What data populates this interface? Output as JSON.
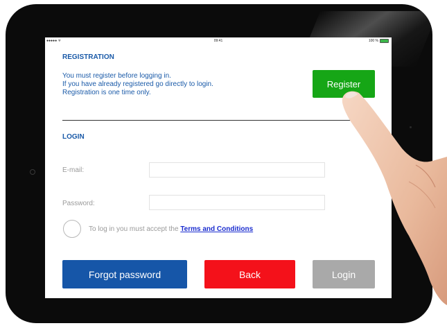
{
  "status_bar": {
    "signal": "●●●●● ᯤ",
    "time": "09:41",
    "battery": "100 %"
  },
  "registration": {
    "title": "REGISTRATION",
    "lines": [
      "You must register before logging in.",
      "If you have already registered go directly to login.",
      "Registration is one time only."
    ],
    "register_label": "Register"
  },
  "login": {
    "title": "LOGIN",
    "email_label": "E-mail:",
    "email_value": "",
    "password_label": "Password:",
    "password_value": "",
    "terms_prefix": "To log in you must accept the",
    "terms_link": "Terms and Conditions"
  },
  "buttons": {
    "forgot_password": "Forgot password",
    "back": "Back",
    "login": "Login"
  },
  "colors": {
    "register": "#16a616",
    "forgot": "#1656a8",
    "back": "#f4111a",
    "login_disabled": "#a9a9a9",
    "heading_blue": "#1a5aa8"
  }
}
